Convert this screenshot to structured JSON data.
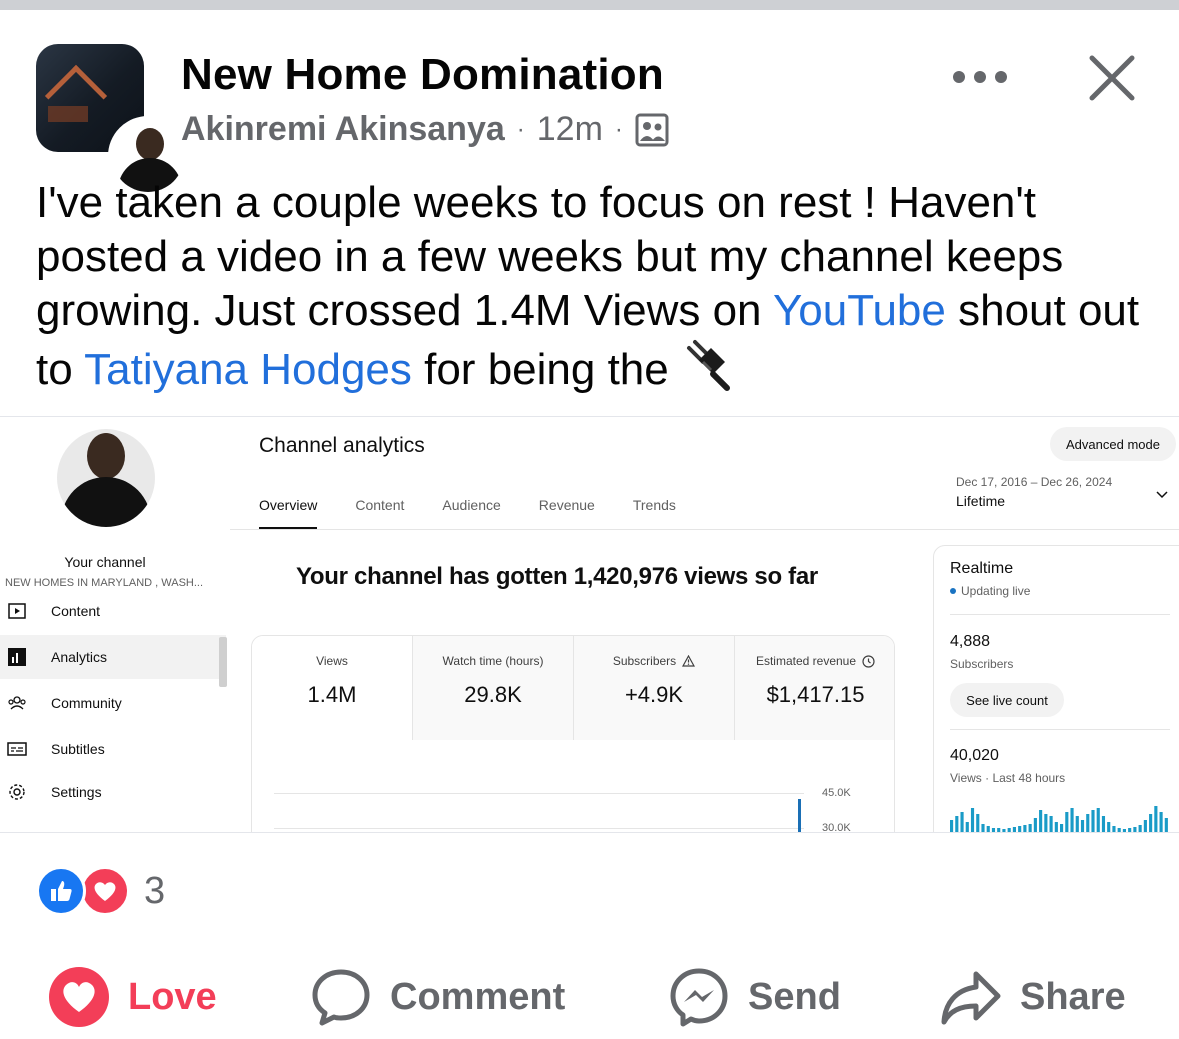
{
  "post": {
    "page_name": "New Home Domination",
    "author": "Akinremi Akinsanya",
    "separator": "·",
    "time": "12m",
    "audience_icon": "group-audience-icon",
    "more_icon": "more-dots-icon",
    "close_icon": "close-icon",
    "text_before_link1": "I've taken a couple weeks to focus on rest ! Haven't posted a video in a few weeks but my channel keeps growing. Just crossed 1.4M Views on ",
    "link1": "YouTube",
    "text_between": " shout out to ",
    "link2": "Tatiyana Hodges",
    "text_after": " for being the ",
    "emoji_icon": "electric-plug-icon"
  },
  "screenshot": {
    "sidebar": {
      "your_channel": "Your channel",
      "channel_subtitle": "NEW HOMES IN MARYLAND , WASH...",
      "items": [
        {
          "label": "Content",
          "icon": "content-icon"
        },
        {
          "label": "Analytics",
          "icon": "analytics-icon"
        },
        {
          "label": "Community",
          "icon": "community-icon"
        },
        {
          "label": "Subtitles",
          "icon": "subtitles-icon"
        },
        {
          "label": "Settings",
          "icon": "gear-icon"
        }
      ]
    },
    "title": "Channel analytics",
    "advanced_mode": "Advanced mode",
    "tabs": [
      "Overview",
      "Content",
      "Audience",
      "Revenue",
      "Trends"
    ],
    "date_range": "Dec 17, 2016 – Dec 26, 2024",
    "date_label": "Lifetime",
    "headline": "Your channel has gotten 1,420,976 views so far",
    "metrics": [
      {
        "label": "Views",
        "value": "1.4M"
      },
      {
        "label": "Watch time (hours)",
        "value": "29.8K"
      },
      {
        "label": "Subscribers",
        "value": "+4.9K"
      },
      {
        "label": "Estimated revenue",
        "value": "$1,417.15"
      }
    ],
    "chart_axis": [
      "45.0K",
      "30.0K"
    ],
    "realtime": {
      "title": "Realtime",
      "status": "Updating live",
      "subscribers_value": "4,888",
      "subscribers_label": "Subscribers",
      "live_count_button": "See live count",
      "views_value": "40,020",
      "views_label": "Views · Last 48 hours"
    }
  },
  "reactions": {
    "count": "3"
  },
  "actions": {
    "love": "Love",
    "comment": "Comment",
    "send": "Send",
    "share": "Share"
  },
  "colors": {
    "link": "#216fdb",
    "love": "#f33e58",
    "like": "#1877f2",
    "muted": "#65676b"
  }
}
